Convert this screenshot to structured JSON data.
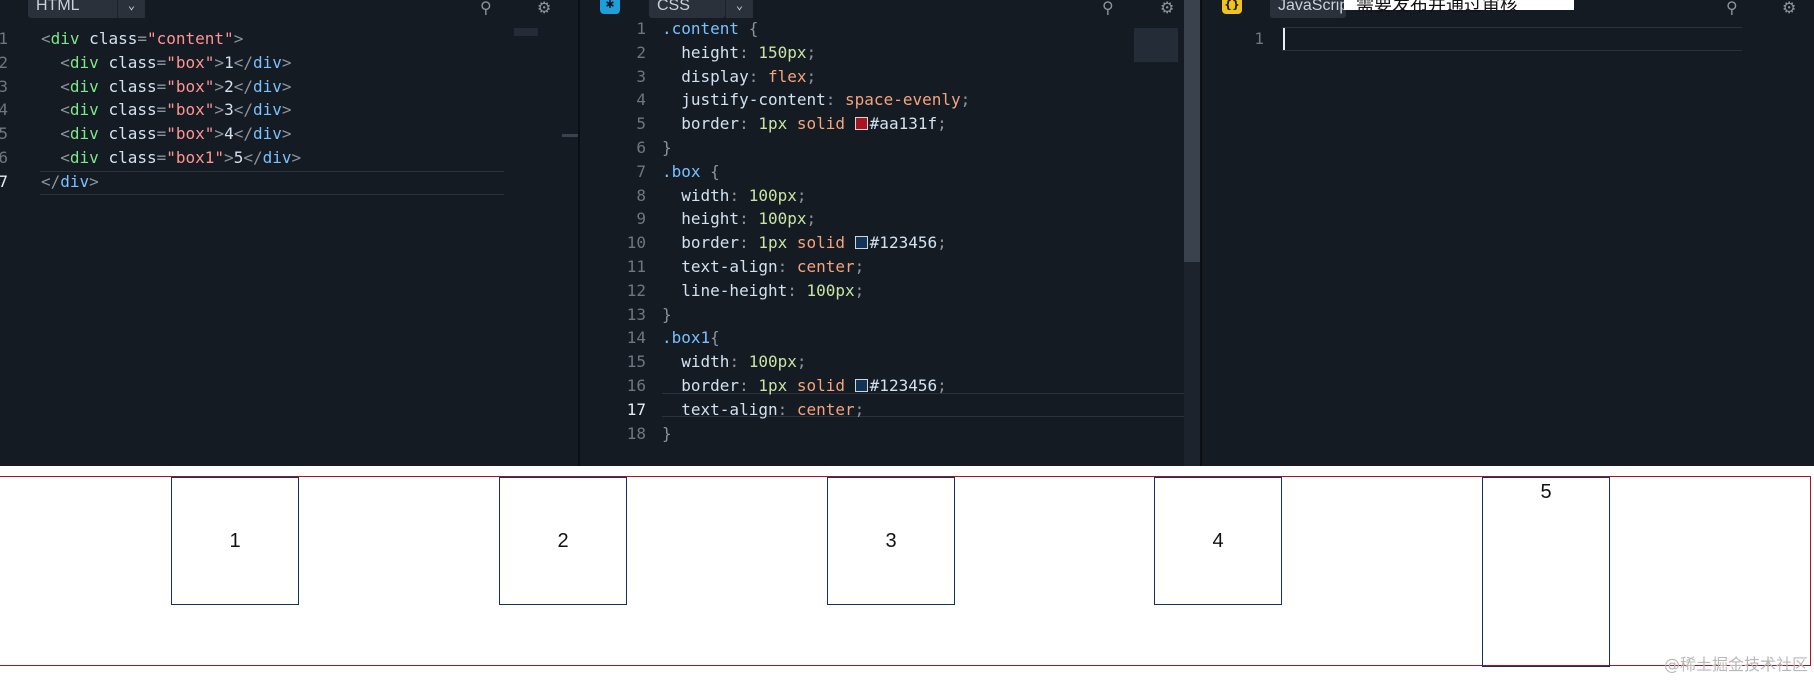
{
  "html_panel": {
    "language": "HTML",
    "lines": [
      {
        "n": "1",
        "parts": [
          [
            "pl",
            "<"
          ],
          [
            "tg",
            "div"
          ],
          [
            "at",
            " class"
          ],
          [
            "pl",
            "="
          ],
          [
            "st",
            "\"content\""
          ],
          [
            "pl",
            ">"
          ]
        ]
      },
      {
        "n": "2",
        "parts": [
          [
            "pl",
            "  <"
          ],
          [
            "tg",
            "div"
          ],
          [
            "at",
            " class"
          ],
          [
            "pl",
            "="
          ],
          [
            "st",
            "\"box\""
          ],
          [
            "pl",
            ">"
          ],
          [
            "at",
            "1"
          ],
          [
            "pl",
            "</"
          ],
          [
            "tgb",
            "div"
          ],
          [
            "pl",
            ">"
          ]
        ]
      },
      {
        "n": "3",
        "parts": [
          [
            "pl",
            "  <"
          ],
          [
            "tg",
            "div"
          ],
          [
            "at",
            " class"
          ],
          [
            "pl",
            "="
          ],
          [
            "st",
            "\"box\""
          ],
          [
            "pl",
            ">"
          ],
          [
            "at",
            "2"
          ],
          [
            "pl",
            "</"
          ],
          [
            "tgb",
            "div"
          ],
          [
            "pl",
            ">"
          ]
        ]
      },
      {
        "n": "4",
        "parts": [
          [
            "pl",
            "  <"
          ],
          [
            "tg",
            "div"
          ],
          [
            "at",
            " class"
          ],
          [
            "pl",
            "="
          ],
          [
            "st",
            "\"box\""
          ],
          [
            "pl",
            ">"
          ],
          [
            "at",
            "3"
          ],
          [
            "pl",
            "</"
          ],
          [
            "tgb",
            "div"
          ],
          [
            "pl",
            ">"
          ]
        ]
      },
      {
        "n": "5",
        "parts": [
          [
            "pl",
            "  <"
          ],
          [
            "tg",
            "div"
          ],
          [
            "at",
            " class"
          ],
          [
            "pl",
            "="
          ],
          [
            "st",
            "\"box\""
          ],
          [
            "pl",
            ">"
          ],
          [
            "at",
            "4"
          ],
          [
            "pl",
            "</"
          ],
          [
            "tgb",
            "div"
          ],
          [
            "pl",
            ">"
          ]
        ]
      },
      {
        "n": "6",
        "parts": [
          [
            "pl",
            "  <"
          ],
          [
            "tg",
            "div"
          ],
          [
            "at",
            " class"
          ],
          [
            "pl",
            "="
          ],
          [
            "st",
            "\"box1\""
          ],
          [
            "pl",
            ">"
          ],
          [
            "at",
            "5"
          ],
          [
            "pl",
            "</"
          ],
          [
            "tgb",
            "div"
          ],
          [
            "pl",
            ">"
          ]
        ]
      },
      {
        "n": "7",
        "parts": [
          [
            "pl",
            "</"
          ],
          [
            "tgb",
            "div"
          ],
          [
            "pl",
            ">"
          ]
        ],
        "active": true
      }
    ]
  },
  "css_panel": {
    "language": "CSS",
    "lines": [
      {
        "n": "1",
        "parts": [
          [
            "sel",
            ".content"
          ],
          [
            "pl",
            " {"
          ]
        ]
      },
      {
        "n": "2",
        "parts": [
          [
            "pr",
            "  height"
          ],
          [
            "pl",
            ": "
          ],
          [
            "nm",
            "150px"
          ],
          [
            "pl",
            ";"
          ]
        ]
      },
      {
        "n": "3",
        "parts": [
          [
            "pr",
            "  display"
          ],
          [
            "pl",
            ": "
          ],
          [
            "vl",
            "flex"
          ],
          [
            "pl",
            ";"
          ]
        ]
      },
      {
        "n": "4",
        "parts": [
          [
            "pr",
            "  justify-content"
          ],
          [
            "pl",
            ": "
          ],
          [
            "vl",
            "space-evenly"
          ],
          [
            "pl",
            ";"
          ]
        ]
      },
      {
        "n": "5",
        "parts": [
          [
            "pr",
            "  border"
          ],
          [
            "pl",
            ": "
          ],
          [
            "nm",
            "1px"
          ],
          [
            "vl",
            " solid "
          ],
          [
            "swatch",
            "#aa131f"
          ],
          [
            "pr",
            "#aa131f"
          ],
          [
            "pl",
            ";"
          ]
        ]
      },
      {
        "n": "6",
        "parts": [
          [
            "pl",
            "}"
          ]
        ]
      },
      {
        "n": "7",
        "parts": [
          [
            "sel",
            ".box"
          ],
          [
            "pl",
            " {"
          ]
        ]
      },
      {
        "n": "8",
        "parts": [
          [
            "pr",
            "  width"
          ],
          [
            "pl",
            ": "
          ],
          [
            "nm",
            "100px"
          ],
          [
            "pl",
            ";"
          ]
        ]
      },
      {
        "n": "9",
        "parts": [
          [
            "pr",
            "  height"
          ],
          [
            "pl",
            ": "
          ],
          [
            "nm",
            "100px"
          ],
          [
            "pl",
            ";"
          ]
        ]
      },
      {
        "n": "10",
        "parts": [
          [
            "pr",
            "  border"
          ],
          [
            "pl",
            ": "
          ],
          [
            "nm",
            "1px"
          ],
          [
            "vl",
            " solid "
          ],
          [
            "swatch",
            "#123456"
          ],
          [
            "pr",
            "#123456"
          ],
          [
            "pl",
            ";"
          ]
        ]
      },
      {
        "n": "11",
        "parts": [
          [
            "pr",
            "  text-align"
          ],
          [
            "pl",
            ": "
          ],
          [
            "vl",
            "center"
          ],
          [
            "pl",
            ";"
          ]
        ]
      },
      {
        "n": "12",
        "parts": [
          [
            "pr",
            "  line-height"
          ],
          [
            "pl",
            ": "
          ],
          [
            "nm",
            "100px"
          ],
          [
            "pl",
            ";"
          ]
        ]
      },
      {
        "n": "13",
        "parts": [
          [
            "pl",
            "}"
          ]
        ]
      },
      {
        "n": "14",
        "parts": [
          [
            "sel",
            ".box1"
          ],
          [
            "pl",
            "{"
          ]
        ]
      },
      {
        "n": "15",
        "parts": [
          [
            "pr",
            "  width"
          ],
          [
            "pl",
            ": "
          ],
          [
            "nm",
            "100px"
          ],
          [
            "pl",
            ";"
          ]
        ]
      },
      {
        "n": "16",
        "parts": [
          [
            "pr",
            "  border"
          ],
          [
            "pl",
            ": "
          ],
          [
            "nm",
            "1px"
          ],
          [
            "vl",
            " solid "
          ],
          [
            "swatch",
            "#123456"
          ],
          [
            "pr",
            "#123456"
          ],
          [
            "pl",
            ";"
          ]
        ]
      },
      {
        "n": "17",
        "parts": [
          [
            "pr",
            "  text-align"
          ],
          [
            "pl",
            ": "
          ],
          [
            "vl",
            "center"
          ],
          [
            "pl",
            ";"
          ]
        ],
        "active": true
      },
      {
        "n": "18",
        "parts": [
          [
            "pl",
            "}"
          ]
        ]
      }
    ]
  },
  "js_panel": {
    "language": "JavaScrip",
    "badge": "{}",
    "lines": [
      {
        "n": "1",
        "parts": []
      }
    ],
    "notice": "需要发布并通过审核"
  },
  "icons": {
    "pin": "pin-icon",
    "settings": "gear-icon",
    "chevron": "chevron-down-icon"
  },
  "preview": {
    "boxes": [
      "1",
      "2",
      "3",
      "4"
    ],
    "box1": "5",
    "content_border": "#aa131f",
    "box_border": "#123456"
  },
  "watermark": "@稀土掘金技术社区"
}
